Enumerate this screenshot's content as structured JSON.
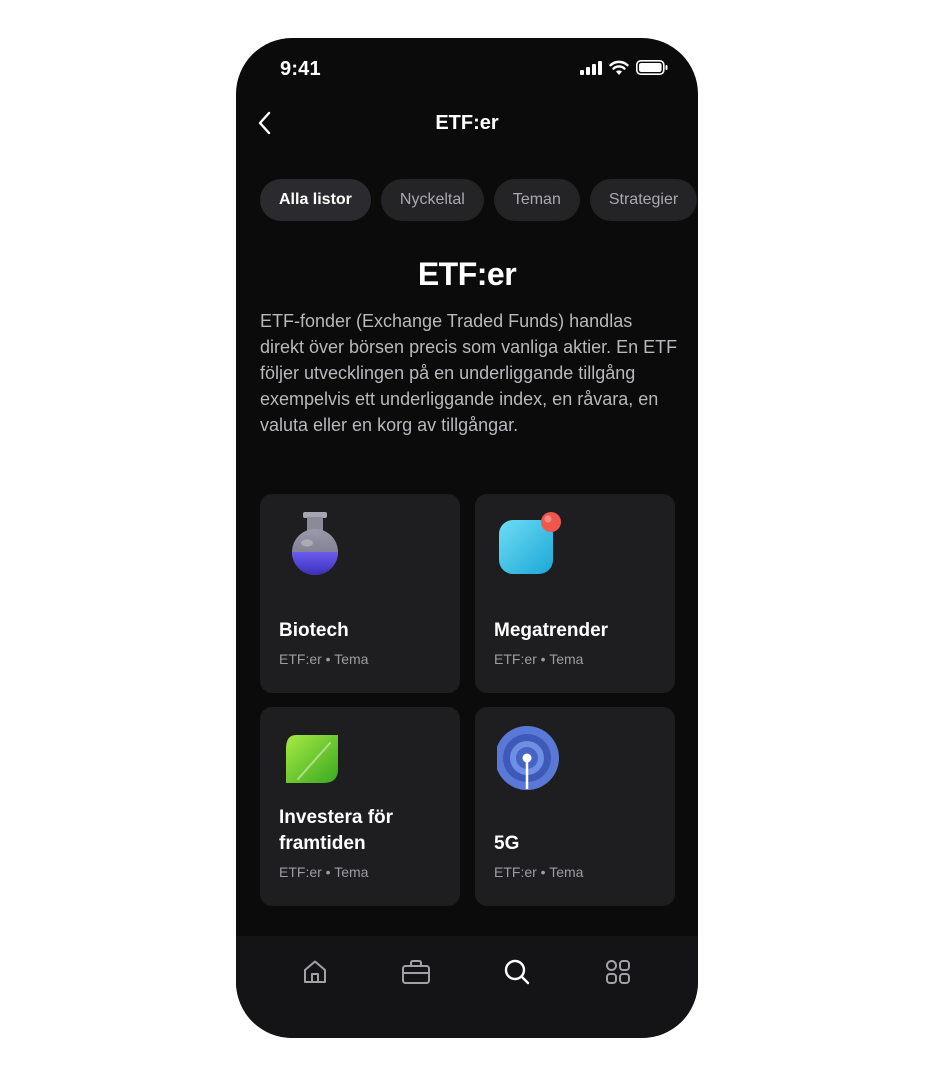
{
  "status": {
    "time": "9:41"
  },
  "header": {
    "title": "ETF:er"
  },
  "chips": [
    "Alla listor",
    "Nyckeltal",
    "Teman",
    "Strategier"
  ],
  "page": {
    "title": "ETF:er",
    "description": "ETF-fonder (Exchange Traded Funds) handlas direkt över börsen precis som vanliga aktier. En ETF följer utvecklingen på en underliggande tillgång exempelvis ett underliggande index, en råvara, en valuta eller en korg av tillgångar."
  },
  "cards": [
    {
      "title": "Biotech",
      "meta": "ETF:er • Tema",
      "icon": "flask-icon"
    },
    {
      "title": "Megatrender",
      "meta": "ETF:er • Tema",
      "icon": "notification-app-icon"
    },
    {
      "title": "Investera för framtiden",
      "meta": "ETF:er • Tema",
      "icon": "leaf-icon"
    },
    {
      "title": "5G",
      "meta": "ETF:er • Tema",
      "icon": "signal-antenna-icon"
    }
  ],
  "tabbar": {
    "items": [
      "home-icon",
      "briefcase-icon",
      "search-icon",
      "grid-icon"
    ]
  },
  "colors": {
    "background": "#0b0b0c",
    "card": "#1e1e21",
    "chip": "#242427",
    "accent_red": "#f0574d"
  }
}
